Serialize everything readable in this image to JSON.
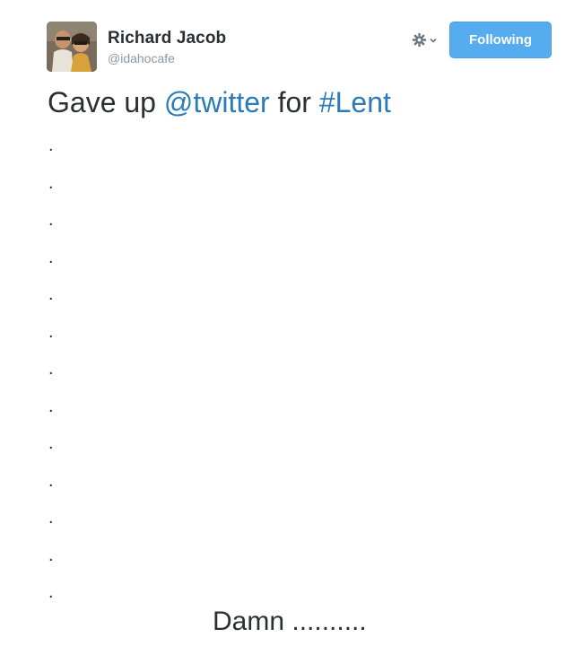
{
  "author": {
    "name": "Richard Jacob",
    "handle": "@idahocafe",
    "avatar_icon": "profile-photo"
  },
  "actions": {
    "settings_icon": "gear-icon",
    "menu_icon": "chevron-down-icon",
    "follow_label": "Following",
    "follow_color": "#55acee"
  },
  "tweet": {
    "text_before": "Gave up ",
    "mention": "@twitter",
    "text_middle": " for ",
    "hashtag": "#Lent",
    "link_color": "#2b7bb9",
    "dot_lines": [
      ".",
      ".",
      ".",
      ".",
      ".",
      ".",
      ".",
      ".",
      ".",
      ".",
      ".",
      ".",
      "."
    ],
    "closing": "Damn .........."
  }
}
